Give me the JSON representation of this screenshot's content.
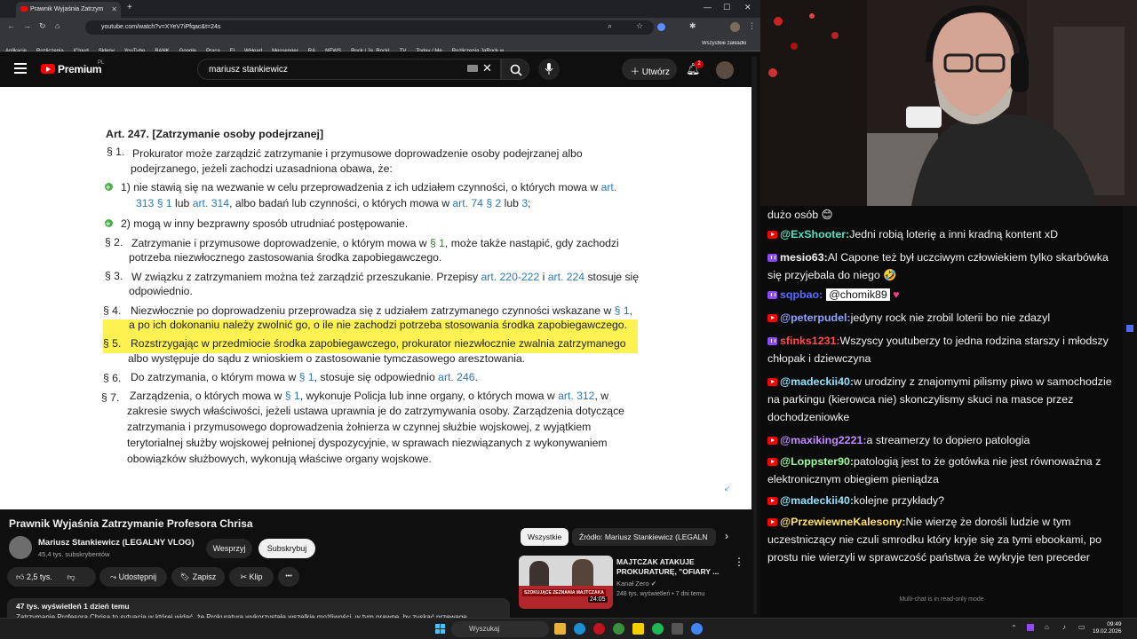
{
  "browser": {
    "tab_title": "Prawnik Wyjaśnia Zatrzym",
    "new_tab": "+",
    "url": "youtube.com/watch?v=XYeV7iPfqac&t=24s",
    "bookmarks": [
      "Aplikacje",
      "Rozliczenia",
      "iCloud",
      "Sklepy",
      "YouTube",
      "BANK",
      "Google",
      "Praca",
      "El",
      "WHead",
      "Messenger",
      "RA",
      "NEWS",
      "Rock | Ja, Rock!",
      "TV",
      "Today / Me",
      "Rozliczenia JaRock w...",
      "Wszystkie zakładki"
    ]
  },
  "youtube": {
    "logo_text": "Premium",
    "logo_sup": "PL",
    "search_value": "mariusz stankiewicz",
    "create_label": "Utwórz",
    "notif_count": "2"
  },
  "document": {
    "heading": "Art.  247.  [Zatrzymanie osoby podejrzanej]",
    "p1_num": "§  1.",
    "p1_line1": "Prokurator może zarządzić zatrzymanie i przymusowe doprowadzenie osoby podejrzanej albo",
    "p1_line2": "podejrzanego, jeżeli zachodzi uzasadniona obawa, że:",
    "item1_a": "1)   nie stawią się na wezwanie w celu przeprowadzenia z ich udziałem czynności, o których mowa w",
    "item1_link1": "art.",
    "item1_b_link": "313 § 1",
    "item1_b_mid": " lub ",
    "item1_b_link2": "art. 314",
    "item1_b_mid2": ", albo badań lub czynności, o których mowa w ",
    "item1_b_link3": "art. 74 § 2",
    "item1_b_mid3": " lub ",
    "item1_b_link4": "3",
    "item1_b_end": ";",
    "item2": "2)   mogą w inny bezprawny sposób utrudniać postępowanie.",
    "p2_num": "§  2.",
    "p2_line1a": "Zatrzymanie i przymusowe doprowadzenie, o którym mowa w ",
    "p2_link": "§ 1",
    "p2_line1b": ", może także nastąpić, gdy zachodzi",
    "p2_line2": "potrzeba niezwłocznego zastosowania środka zapobiegawczego.",
    "p3_num": "§  3.",
    "p3_line1a": "W związku z zatrzymaniem można też zarządzić przeszukanie. Przepisy ",
    "p3_link1": "art. 220-222",
    "p3_mid": " i ",
    "p3_link2": "art. 224",
    "p3_line1b": " stosuje się",
    "p3_line2": "odpowiednio.",
    "p4_num": "§  4.",
    "p4_line1a": "Niezwłocznie po doprowadzeniu przeprowadza się z udziałem zatrzymanego czynności wskazane w ",
    "p4_link": "§ 1",
    "p4_line1b": ",",
    "p4_line2": "a po ich dokonaniu należy zwolnić go, o ile nie zachodzi potrzeba stosowania środka zapobiegawczego.",
    "p5_num": "§  5.",
    "p5_line1": "Rozstrzygając w przedmiocie środka zapobiegawczego, prokurator niezwłocznie zwalnia zatrzymanego",
    "p5_line2": "albo występuje do sądu z wnioskiem o zastosowanie tymczasowego aresztowania.",
    "p6_num": "§  6.",
    "p6_a": "Do zatrzymania, o którym mowa w ",
    "p6_link1": "§ 1",
    "p6_b": ", stosuje się odpowiednio ",
    "p6_link2": "art. 246",
    "p6_c": ".",
    "p7_num": "§  7.",
    "p7_line1a": "Zarządzenia, o których mowa w ",
    "p7_link1": "§ 1",
    "p7_line1b": ", wykonuje Policja lub inne organy, o których mowa w ",
    "p7_link2": "art. 312",
    "p7_line1c": ", w",
    "p7_line2": "zakresie swych właściwości, jeżeli ustawa uprawnia je do zatrzymywania osoby. Zarządzenia dotyczące",
    "p7_line3": "zatrzymania i przymusowego doprowadzenia żołnierza w czynnej służbie wojskowej, z wyjątkiem",
    "p7_line4": "terytorialnej służby wojskowej pełnionej dyspozycyjnie, w sprawach niezwiązanych z wykonywaniem",
    "p7_line5": "obowiązków służbowych, wykonują właściwe organy wojskowe."
  },
  "video": {
    "title": "Prawnik Wyjaśnia Zatrzymanie Profesora Chrisa",
    "channel": "Mariusz Stankiewicz (LEGALNY VLOG)",
    "subs": "45,4 tys. subskrybentów",
    "support": "Wesprzyj",
    "subscribe": "Subskrybuj",
    "likes": "2,5 tys.",
    "share": "Udostępnij",
    "save": "Zapisz",
    "clip": "Klip",
    "more": "•••",
    "desc_meta": "47 tys. wyświetleń  1 dzień temu",
    "desc_text": "Zatrzymanie Profesora Chrisa to sytuacja w której widać, że Prokuratura wykorzystała wszelkie możliwości, w tym prawne, by zyskać przewagę"
  },
  "sidebar": {
    "chip_all": "Wszystkie",
    "chip_source": "Źródło: Mariusz Stankiewicz (LEGALN",
    "rec_title": "MAJTCZAK ATAKUJE PROKURATURĘ, \"OFIARY ...",
    "rec_channel": "Kanał Zero",
    "rec_meta": "248 tys. wyświetleń • 7 dni temu",
    "rec_duration": "24:05",
    "thumb_text": "SZOKUJĄCE ZEZNANIA MAJTCZAKA"
  },
  "chat": {
    "messages": [
      {
        "platform": "",
        "user": "",
        "text": "dużo osób 😊",
        "color": ""
      },
      {
        "platform": "yt",
        "user": "@ExShooter:",
        "text": "Jedni robią loterię a inni kradną kontent xD",
        "color": "#54e0c4"
      },
      {
        "platform": "tw",
        "user": "mesio63:",
        "text": "Al Capone też był uczciwym człowiekiem tylko skarbówka się przyjebala do niego 🤣",
        "color": "#f2f2f2"
      },
      {
        "platform": "tw",
        "user": "sqpbao:",
        "text": "@chomik89",
        "color": "#5b6bff"
      },
      {
        "platform": "yt",
        "user": "@peterpudel:",
        "text": "jedyny rock nie zrobil loterii bo nie zdazyl",
        "color": "#8fa3ff"
      },
      {
        "platform": "tw",
        "user": "sfinks1231:",
        "text": "Wszyscy youtuberzy to jedna rodzina starszy i młodszy chłopak i dziewczyna",
        "color": "#ff4d4d"
      },
      {
        "platform": "yt",
        "user": "@madeckii40:",
        "text": "w urodziny z znajomymi pilismy piwo w samochodzie na parkingu (kierowca nie) skonczylismy skuci na masce przez dochodzeniowke",
        "color": "#8fe3ff"
      },
      {
        "platform": "yt",
        "user": "@maxiking2221:",
        "text": "a streamerzy to dopiero patologia",
        "color": "#c58aff"
      },
      {
        "platform": "yt",
        "user": "@Loppster90:",
        "text": "patologią jest to że gotówka nie jest równoważna z elektronicznym obiegiem pieniądza",
        "color": "#9cff9c"
      },
      {
        "platform": "yt",
        "user": "@madeckii40:",
        "text": "kolejne przykłady?",
        "color": "#8fe3ff"
      },
      {
        "platform": "yt",
        "user": "@PrzewiewneKalesony:",
        "text": "Nie wierzę że dorośli ludzie w tym uczestniczący nie czuli smrodku który kryje się za tymi ebookami, po prostu nie wierzyli w sprawczość państwa że wykryje ten preceder",
        "color": "#ffe066"
      }
    ],
    "readonly": "Multi-chat is in read-only mode"
  },
  "taskbar": {
    "search": "Wyszukaj",
    "time": "09:49",
    "date": "19.02.2026"
  }
}
